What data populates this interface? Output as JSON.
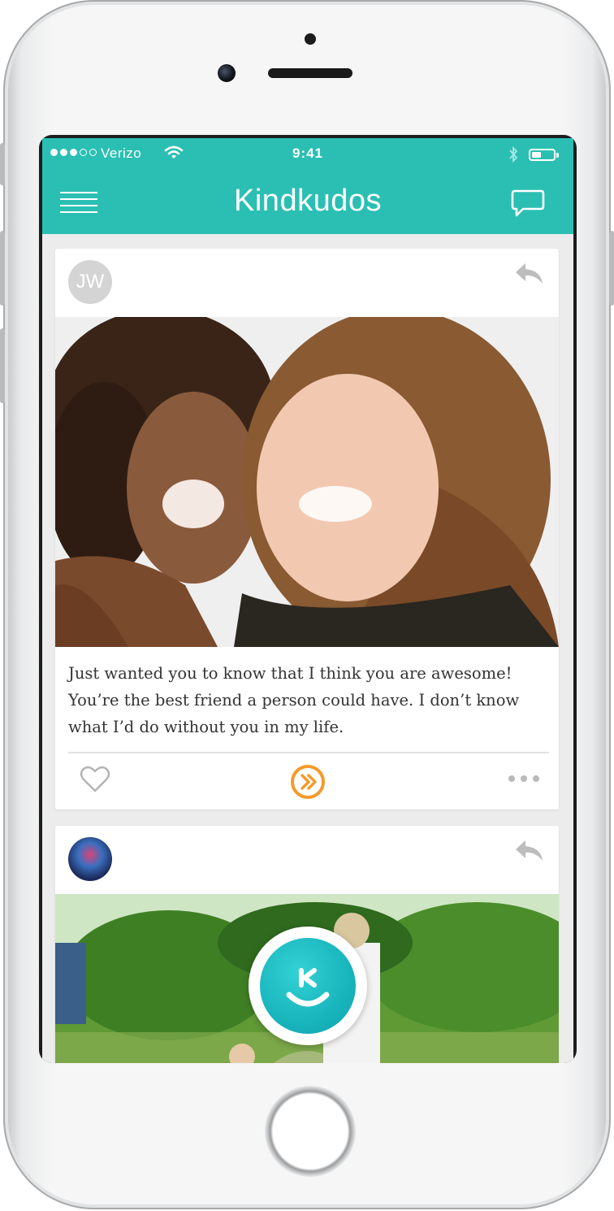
{
  "status_bar": {
    "carrier": "Verizo",
    "time": "9:41"
  },
  "app": {
    "title": "Kindkudos",
    "brand_color": "#2bbfb3",
    "accent_color": "#f59a2c"
  },
  "feed": {
    "posts": [
      {
        "avatar_initials": "JW",
        "image": "two-women-smiling-photo",
        "message": "Just wanted you to know that I think you are awesome! You’re the best friend a person could have. I don’t know what I’d do without you in my life."
      },
      {
        "avatar_initials": "",
        "image": "park-path-photo"
      }
    ]
  },
  "icons": {
    "menu": "hamburger-icon",
    "chat": "chat-bubble-icon",
    "reply": "reply-arrow-icon",
    "like": "heart-icon",
    "kudos": "kudos-arrow-icon",
    "more": "more-dots-icon",
    "fab": "smile-k-icon"
  }
}
